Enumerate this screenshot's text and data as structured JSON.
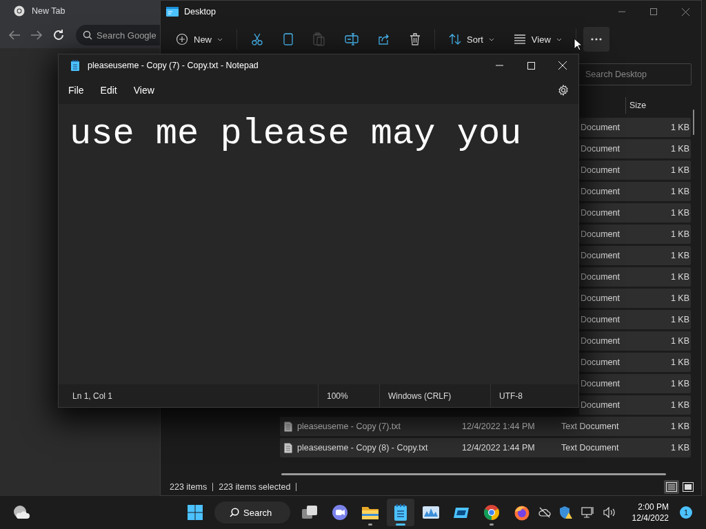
{
  "browser": {
    "tab": {
      "title": "New Tab"
    },
    "address_bar": {
      "placeholder": "Search Google"
    }
  },
  "explorer": {
    "title": "Desktop",
    "toolbar": [
      {
        "kind": "new",
        "label": "New",
        "disabled": false,
        "hovered": false
      },
      {
        "kind": "cut",
        "disabled": false,
        "hovered": false
      },
      {
        "kind": "copy",
        "disabled": false,
        "hovered": false
      },
      {
        "kind": "paste",
        "disabled": true,
        "hovered": false
      },
      {
        "kind": "rename",
        "disabled": false,
        "hovered": false
      },
      {
        "kind": "share",
        "disabled": false,
        "hovered": false
      },
      {
        "kind": "delete",
        "disabled": false,
        "hovered": false
      },
      {
        "kind": "sort",
        "label": "Sort",
        "disabled": false,
        "hovered": false
      },
      {
        "kind": "view",
        "label": "View",
        "disabled": false,
        "hovered": false
      },
      {
        "kind": "more",
        "disabled": false,
        "hovered": true
      }
    ],
    "search": {
      "placeholder": "Search Desktop"
    },
    "column_header": "Size",
    "rows": [
      {
        "type": "Document",
        "size": "1 KB",
        "selected": true
      },
      {
        "type": "Document",
        "size": "1 KB",
        "selected": true
      },
      {
        "type": "Document",
        "size": "1 KB",
        "selected": true
      },
      {
        "type": "Document",
        "size": "1 KB",
        "selected": true
      },
      {
        "type": "Document",
        "size": "1 KB",
        "selected": true
      },
      {
        "type": "Document",
        "size": "1 KB",
        "selected": true
      },
      {
        "type": "Document",
        "size": "1 KB",
        "selected": true
      },
      {
        "type": "Document",
        "size": "1 KB",
        "selected": true
      },
      {
        "type": "Document",
        "size": "1 KB",
        "selected": true
      },
      {
        "type": "Document",
        "size": "1 KB",
        "selected": true
      },
      {
        "type": "Document",
        "size": "1 KB",
        "selected": true
      },
      {
        "type": "Document",
        "size": "1 KB",
        "selected": true
      },
      {
        "type": "Document",
        "size": "1 KB",
        "selected": true
      },
      {
        "type": "Document",
        "size": "1 KB",
        "selected": true
      },
      {
        "name": "pleaseuseme - Copy (7).txt",
        "date": "12/4/2022 1:44 PM",
        "type": "Text Document",
        "size": "1 KB",
        "selected": true
      },
      {
        "name": "pleaseuseme - Copy (8) - Copy.txt",
        "date": "12/4/2022 1:44 PM",
        "type": "Text Document",
        "size": "1 KB",
        "selected": true
      }
    ],
    "status": {
      "count": "223 items",
      "selection": "223 items selected"
    },
    "view_buttons": [
      {
        "kind": "details",
        "selected": true
      },
      {
        "kind": "tiles",
        "selected": false
      }
    ]
  },
  "notepad": {
    "title": "pleaseuseme - Copy (7) - Copy.txt - Notepad",
    "menu": [
      "File",
      "Edit",
      "View"
    ],
    "text": "use me please may you",
    "status": {
      "position": "Ln 1, Col 1",
      "zoom": "100%",
      "line_endings": "Windows (CRLF)",
      "encoding": "UTF-8"
    }
  },
  "taskbar": {
    "search_label": "Search",
    "apps": [
      {
        "kind": "taskview",
        "running": false,
        "active": false
      },
      {
        "kind": "chat",
        "running": false,
        "active": false
      },
      {
        "kind": "explorer",
        "running": true,
        "active": false
      },
      {
        "kind": "notepad",
        "running": true,
        "active": true
      },
      {
        "kind": "monitor",
        "running": false,
        "active": false
      },
      {
        "kind": "app",
        "running": false,
        "active": false
      },
      {
        "kind": "chrome",
        "running": true,
        "active": false
      },
      {
        "kind": "firefox",
        "running": false,
        "active": false
      }
    ],
    "tray": [
      {
        "kind": "network-off"
      },
      {
        "kind": "security-warning"
      },
      {
        "kind": "display"
      },
      {
        "kind": "volume"
      }
    ],
    "time": "2:00 PM",
    "date": "12/4/2022",
    "notifications": "1"
  }
}
